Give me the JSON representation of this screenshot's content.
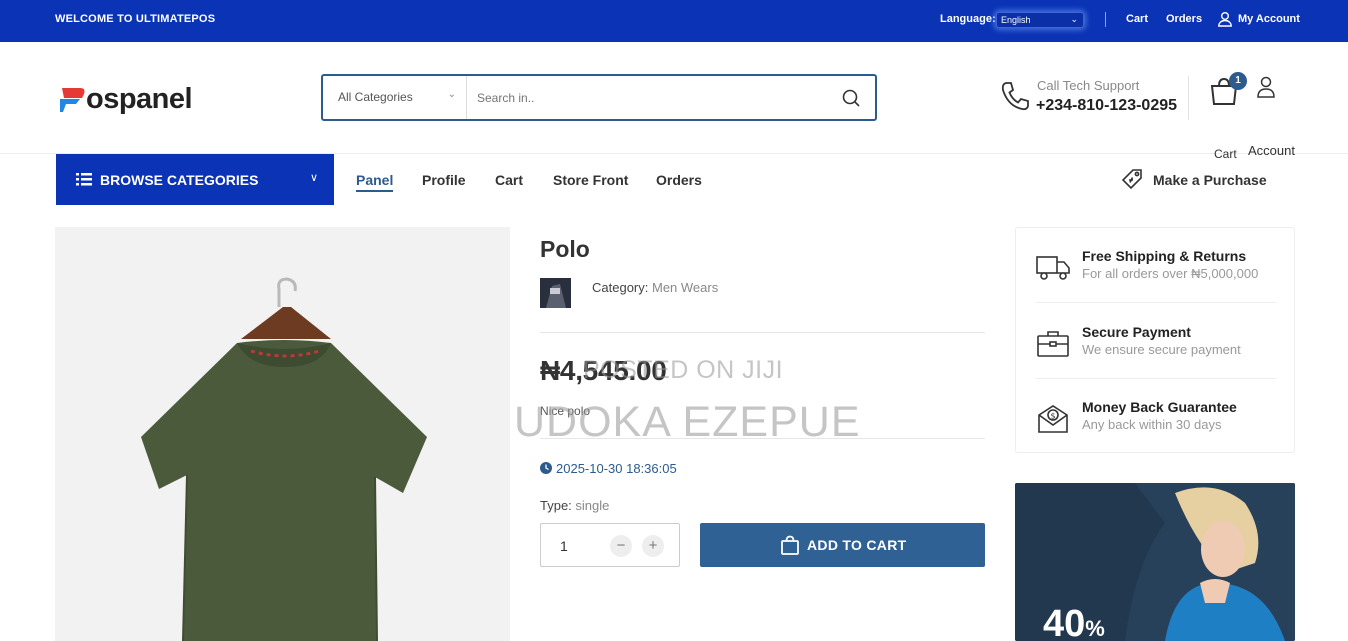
{
  "topbar": {
    "welcome": "WELCOME TO ULTIMATEPOS",
    "language_label": "Language:",
    "language_value": "English",
    "links": [
      "Cart",
      "Orders",
      "My Account"
    ]
  },
  "header": {
    "logo_text": "ospanel",
    "search": {
      "category": "All Categories",
      "placeholder": "Search in.."
    },
    "support_label": "Call Tech Support",
    "support_phone": "+234-810-123-0295",
    "cart_label": "Cart",
    "cart_count": "1",
    "account_label": "Account"
  },
  "nav": {
    "browse_label": "BROWSE CATEGORIES",
    "links": [
      "Panel",
      "Profile",
      "Cart",
      "Store Front",
      "Orders"
    ],
    "active": "Panel",
    "purchase_label": "Make a Purchase"
  },
  "product": {
    "title": "Polo",
    "category_label": "Category:",
    "category_value": "Men Wears",
    "price": "₦4,545.00",
    "watermark_1": "POSTED ON JIJI",
    "watermark_2": "UDOKA EZEPUE",
    "description": "Nice polo",
    "date": "2025-10-30 18:36:05",
    "type_label": "Type:",
    "type_value": "single",
    "quantity": "1",
    "add_to_cart": "ADD TO CART"
  },
  "features": [
    {
      "title": "Free Shipping & Returns",
      "subtitle": "For all orders over ₦5,000,000",
      "icon": "truck-icon"
    },
    {
      "title": "Secure Payment",
      "subtitle": "We ensure secure payment",
      "icon": "briefcase-icon"
    },
    {
      "title": "Money Back Guarantee",
      "subtitle": "Any back within 30 days",
      "icon": "money-envelope-icon"
    }
  ],
  "banner": {
    "percent": "40",
    "percent_sign": "%"
  },
  "colors": {
    "topbar": "#0a33b5",
    "accent": "#2c5b8e",
    "add_to_cart": "#2f6194"
  }
}
